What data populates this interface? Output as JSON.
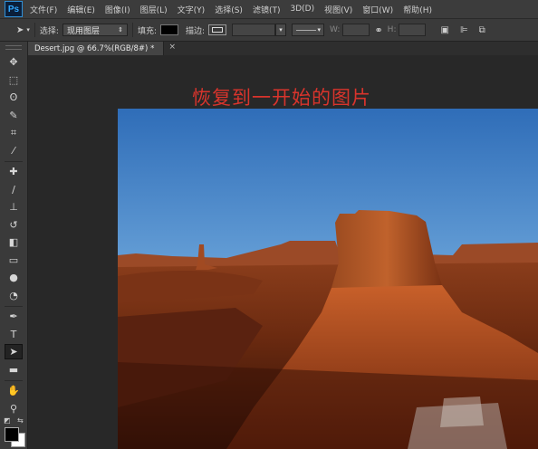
{
  "app": {
    "logo": "Ps"
  },
  "menu": [
    "文件(F)",
    "编辑(E)",
    "图像(I)",
    "图层(L)",
    "文字(Y)",
    "选择(S)",
    "滤镜(T)",
    "3D(D)",
    "视图(V)",
    "窗口(W)",
    "帮助(H)"
  ],
  "options": {
    "select_label": "选择:",
    "select_value": "现用图层",
    "fill_label": "填充:",
    "stroke_label": "描边:",
    "w_label": "W:",
    "h_label": "H:",
    "fill_color": "#000000"
  },
  "document": {
    "tab_title": "Desert.jpg @ 66.7%(RGB/8#) *",
    "close_glyph": "×"
  },
  "canvas": {
    "overlay_text": "恢复到一开始的图片",
    "overlay_color": "#d9342c"
  },
  "tools": [
    {
      "name": "move-tool",
      "glyph": "✥"
    },
    {
      "name": "marquee-tool",
      "glyph": "⬚"
    },
    {
      "name": "lasso-tool",
      "glyph": "ʘ"
    },
    {
      "name": "quick-select-tool",
      "glyph": "✎"
    },
    {
      "name": "crop-tool",
      "glyph": "⌗"
    },
    {
      "name": "eyedropper-tool",
      "glyph": "⁄"
    },
    {
      "name": "healing-brush-tool",
      "glyph": "✚"
    },
    {
      "name": "brush-tool",
      "glyph": "∕"
    },
    {
      "name": "clone-stamp-tool",
      "glyph": "⊥"
    },
    {
      "name": "history-brush-tool",
      "glyph": "↺"
    },
    {
      "name": "eraser-tool",
      "glyph": "◧"
    },
    {
      "name": "gradient-tool",
      "glyph": "▭"
    },
    {
      "name": "blur-tool",
      "glyph": "●"
    },
    {
      "name": "dodge-tool",
      "glyph": "◔"
    },
    {
      "name": "pen-tool",
      "glyph": "✒"
    },
    {
      "name": "type-tool",
      "glyph": "T"
    },
    {
      "name": "path-selection-tool",
      "glyph": "➤"
    },
    {
      "name": "rectangle-tool",
      "glyph": "▬"
    },
    {
      "name": "hand-tool",
      "glyph": "✋"
    },
    {
      "name": "zoom-tool",
      "glyph": "⚲"
    }
  ]
}
